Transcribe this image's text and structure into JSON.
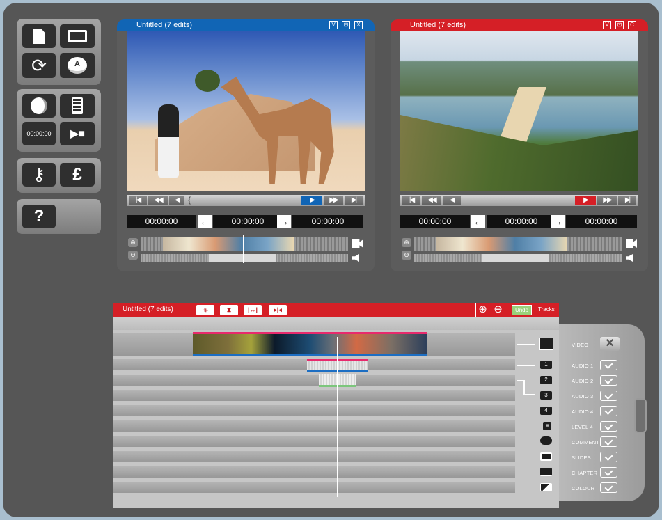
{
  "toolbox": {
    "timecode_label": "00:00:00",
    "help_label": "?",
    "currency_label": "£",
    "disc_label": "A"
  },
  "viewer_left": {
    "title": "Untitled (7 edits)",
    "title_buttons": [
      "V",
      "⊡",
      "X"
    ],
    "timecodes": [
      "00:00:00",
      "00:00:00",
      "00:00:00"
    ],
    "accent": "#1165b5"
  },
  "viewer_right": {
    "title": "Untitled (7 edits)",
    "title_buttons": [
      "V",
      "⊡",
      "C"
    ],
    "timecodes": [
      "00:00:00",
      "00:00:00",
      "00:00:00"
    ],
    "accent": "#d51f26"
  },
  "transport": {
    "start": "|◀",
    "rewind": "◀◀",
    "step_back": "◀",
    "play": "▶",
    "forward": "▶▶",
    "end": "▶|",
    "mark_in": "{"
  },
  "timeline": {
    "title": "Untitled (7 edits)",
    "tools": [
      "⟛",
      "⧗",
      "|↔|",
      "▸|◂"
    ],
    "zoom_in": "⊕",
    "zoom_out": "⊖",
    "undo": "Undo",
    "tracks": "Tracks",
    "accent": "#d51f26"
  },
  "tracks": [
    {
      "label": "VIDEO",
      "icon": "video-icon",
      "enabled": false
    },
    {
      "label": "AUDIO 1",
      "icon": "speaker-icon",
      "num": "1",
      "enabled": true
    },
    {
      "label": "AUDIO 2",
      "icon": "speaker-icon",
      "num": "2",
      "enabled": true
    },
    {
      "label": "AUDIO 3",
      "icon": "speaker-icon",
      "num": "3",
      "enabled": true
    },
    {
      "label": "AUDIO 4",
      "icon": "speaker-icon",
      "num": "4",
      "enabled": true
    },
    {
      "label": "LEVEL 4",
      "icon": "level-icon",
      "enabled": true
    },
    {
      "label": "COMMENT",
      "icon": "speech-bubble-icon",
      "enabled": true
    },
    {
      "label": "SLIDES",
      "icon": "slide-icon",
      "enabled": true
    },
    {
      "label": "CHAPTER",
      "icon": "book-icon",
      "enabled": true
    },
    {
      "label": "COLOUR",
      "icon": "colour-icon",
      "enabled": true
    }
  ]
}
